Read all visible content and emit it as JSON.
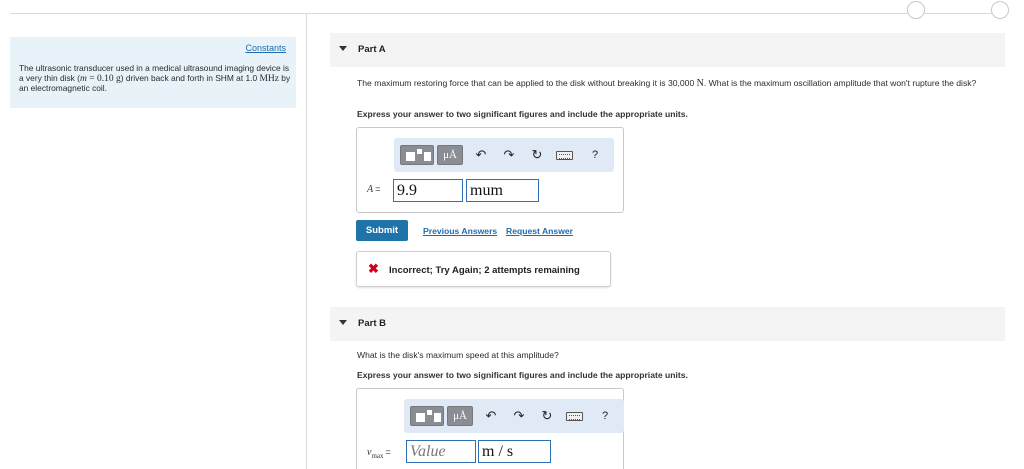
{
  "sidebar": {
    "constants_link": "Constants",
    "problem": {
      "text_1": "The ultrasonic transducer used in a medical ultrasound imaging device is a very thin disk (",
      "mass_var": "m",
      "mass_value": " = 0.10 g",
      "text_2": ") driven back and forth in SHM at 1.0 ",
      "freq_unit": "MHz",
      "text_3": " by an electromagnetic coil."
    }
  },
  "toolbar": {
    "units_label": "μÅ",
    "undo_icon": "undo-icon",
    "redo_icon": "redo-icon",
    "reset_icon": "reset-icon",
    "keyboard_icon": "keyboard-icon",
    "help_label": "?"
  },
  "part_a": {
    "title": "Part A",
    "question_1": "The maximum restoring force that can be applied to the disk without breaking it is 30,000 ",
    "force_unit": "N",
    "question_2": ". What is the maximum oscillation amplitude that won't rupture the disk?",
    "instruction": "Express your answer to two significant figures and include the appropriate units.",
    "var_label": "A",
    "equals": "=",
    "value": "9.9",
    "unit_value": "mum",
    "submit_label": "Submit",
    "previous_answers_label": "Previous Answers",
    "request_answer_label": "Request Answer",
    "feedback_icon": "✖",
    "feedback_text": "Incorrect; Try Again; 2 attempts remaining"
  },
  "part_b": {
    "title": "Part B",
    "question": "What is the disk's maximum speed at this amplitude?",
    "instruction": "Express your answer to two significant figures and include the appropriate units.",
    "var_label": "v",
    "var_sub": "max",
    "equals": "=",
    "value_placeholder": "Value",
    "unit_value": "m / s"
  },
  "colors": {
    "link": "#1f6bb0",
    "submit": "#1f73a8",
    "error": "#d0021b",
    "info_panel": "#e7f3f8",
    "toolbar": "#dfeaf6",
    "input_border": "#2f6fb8"
  }
}
